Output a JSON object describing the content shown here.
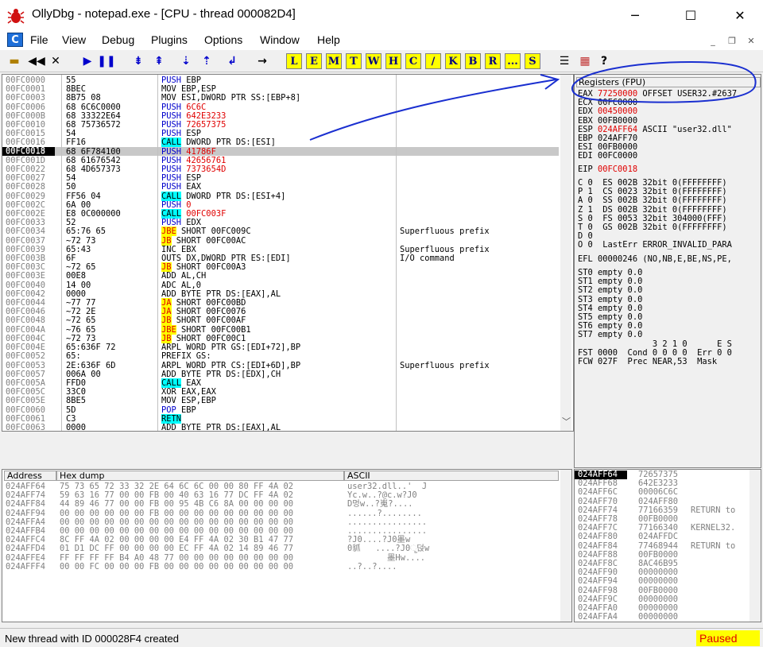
{
  "window": {
    "title": "OllyDbg - notepad.exe - [CPU - thread 000082D4]",
    "minimize": "─",
    "maximize": "☐",
    "close": "✕"
  },
  "menu": {
    "icon": "C",
    "items": [
      "File",
      "View",
      "Debug",
      "Plugins",
      "Options",
      "Window",
      "Help"
    ],
    "mdi_min": "_",
    "mdi_restore": "❐",
    "mdi_close": "✕"
  },
  "toolbar": {
    "letters": [
      "L",
      "E",
      "M",
      "T",
      "W",
      "H",
      "C",
      "/",
      "K",
      "B",
      "R",
      "...",
      "S"
    ]
  },
  "cpu": {
    "addresses": "00FC0000\n00FC0001\n00FC0003\n00FC0006\n00FC000B\n00FC0010\n00FC0015\n00FC0016\n00FC0018\n00FC001D\n00FC0022\n00FC0027\n00FC0028\n00FC0029\n00FC002C\n00FC002E\n00FC0033\n00FC0034\n00FC0037\n00FC0039\n00FC003B\n00FC003C\n00FC003E\n00FC0040\n00FC0042\n00FC0044\n00FC0046\n00FC0048\n00FC004A\n00FC004C\n00FC004E\n00FC0052\n00FC0053\n00FC0057\n00FC005A\n00FC005C\n00FC005E\n00FC0060\n00FC0061\n00FC0063",
    "hex": "55\n8BEC\n8B75 08\n68 6C6C0000\n68 33322E64\n68 75736572\n54\nFF16\n68 6F784100\n68 61676542\n68 4D657373\n54\n50\nFF56 04\n6A 00\nE8 0C000000\n52\n65:76 65\n~72 73\n65:43\n6F\n~72 65\n00E8\n14 00\n0000\n~77 77\n~72 2E\n~72 65\n~76 65\n~72 73\n65:636F 72\n65:\n2E:636F 6D\n006A 00\nFFD0\n33C0\n8BE5\n5D\nC3\n0000",
    "disasm": [
      "PUSH EBP",
      "MOV EBP,ESP",
      "MOV ESI,DWORD PTR SS:[EBP+8]",
      "PUSH 6C6C",
      "PUSH 642E3233",
      "PUSH 72657375",
      "PUSH ESP",
      "CALL DWORD PTR DS:[ESI]",
      "PUSH 41786F",
      "PUSH 42656761",
      "PUSH 7373654D",
      "PUSH ESP",
      "PUSH EAX",
      "CALL DWORD PTR DS:[ESI+4]",
      "PUSH 0",
      "CALL 00FC003F",
      "PUSH EDX",
      "JBE SHORT 00FC009C",
      "JB SHORT 00FC00AC",
      "INC EBX",
      "OUTS DX,DWORD PTR ES:[EDI]",
      "JB SHORT 00FC00A3",
      "ADD AL,CH",
      "ADC AL,0",
      "ADD BYTE PTR DS:[EAX],AL",
      "JA SHORT 00FC00BD",
      "JA SHORT 00FC0076",
      "JB SHORT 00FC00AF",
      "JBE SHORT 00FC00B1",
      "JB SHORT 00FC00C1",
      "ARPL WORD PTR GS:[EDI+72],BP",
      "PREFIX GS:",
      "ARPL WORD PTR CS:[EDI+6D],BP",
      "ADD BYTE PTR DS:[EDX],CH",
      "CALL EAX",
      "XOR EAX,EAX",
      "MOV ESP,EBP",
      "POP EBP",
      "RETN",
      "ADD BYTE PTR DS:[EAX],AL"
    ],
    "comments": "\n\n\n\n\n\n\n\n\n\n\n\n\n\n\n\n\nSuperfluous prefix\n\nSuperfluous prefix\nI/O command\n\n\n\n\n\n\n\n\n\n\n\nSuperfluous prefix\n\n\n\n\n\n\n"
  },
  "registers": {
    "title": "Registers (FPU)",
    "gp": [
      {
        "name": "EAX",
        "value": "77250000",
        "comment": "OFFSET USER32.#2637"
      },
      {
        "name": "ECX",
        "value": "00FC0000",
        "comment": ""
      },
      {
        "name": "EDX",
        "value": "00450000",
        "comment": ""
      },
      {
        "name": "EBX",
        "value": "00FB0000",
        "comment": ""
      },
      {
        "name": "ESP",
        "value": "024AFF64",
        "comment": "ASCII \"user32.dll\""
      },
      {
        "name": "EBP",
        "value": "024AFF70",
        "comment": ""
      },
      {
        "name": "ESI",
        "value": "00FB0000",
        "comment": ""
      },
      {
        "name": "EDI",
        "value": "00FC0000",
        "comment": ""
      }
    ],
    "eip": "EIP 00FC0018",
    "flags": "C 0  ES 002B 32bit 0(FFFFFFFF)\nP 1  CS 0023 32bit 0(FFFFFFFF)\nA 0  SS 002B 32bit 0(FFFFFFFF)\nZ 1  DS 002B 32bit 0(FFFFFFFF)\nS 0  FS 0053 32bit 304000(FFF)\nT 0  GS 002B 32bit 0(FFFFFFFF)\nD 0\nO 0  LastErr ERROR_INVALID_PARA",
    "efl": "EFL 00000246 (NO,NB,E,BE,NS,PE,",
    "fpu": "ST0 empty 0.0\nST1 empty 0.0\nST2 empty 0.0\nST3 empty 0.0\nST4 empty 0.0\nST5 empty 0.0\nST6 empty 0.0\nST7 empty 0.0\n               3 2 1 0      E S\nFST 0000  Cond 0 0 0 0  Err 0 0\nFCW 027F  Prec NEAR,53  Mask"
  },
  "dump": {
    "headers": [
      "Address",
      "Hex dump",
      "ASCII"
    ],
    "addresses": "024AFF64\n024AFF74\n024AFF84\n024AFF94\n024AFFA4\n024AFFB4\n024AFFC4\n024AFFD4\n024AFFE4\n024AFFF4",
    "hex": "75 73 65 72 33 32 2E 64 6C 6C 00 00 80 FF 4A 02\n59 63 16 77 00 00 FB 00 40 63 16 77 DC FF 4A 02\n44 89 46 77 00 00 FB 00 95 4B C6 8A 00 00 00 00\n00 00 00 00 00 00 FB 00 00 00 00 00 00 00 00 00\n00 00 00 00 00 00 00 00 00 00 00 00 00 00 00 00\n00 00 00 00 00 00 00 00 00 00 00 00 00 00 00 00\n8C FF 4A 02 00 00 00 00 E4 FF 4A 02 30 B1 47 77\n01 D1 DC FF 00 00 00 00 EC FF 4A 02 14 89 46 77\nFF FF FF FF B4 A0 48 77 00 00 00 00 00 00 00 00\n00 00 FC 00 00 00 FB 00 00 00 00 00 00 00 00 00",
    "ascii": "user32.dll..'  J\nYc.w..?@c.w?J0\nD멍w..?嵬?....\n......?........\n................\n................\n?J0....?J0墨w\n0䝖   ....?J0ୄ덙w\n        墨Hw....\n..?..?...."
  },
  "stack": {
    "addresses": "024AFF64\n024AFF68\n024AFF6C\n024AFF70\n024AFF74\n024AFF78\n024AFF7C\n024AFF80\n024AFF84\n024AFF88\n024AFF8C\n024AFF90\n024AFF94\n024AFF98\n024AFF9C\n024AFFA0\n024AFFA4",
    "values": "72657375\n642E3233\n00006C6C\n024AFF80\n77166359\n00FB0000\n77166340\n024AFFDC\n77468944\n00FB0000\n8AC46B95\n00000000\n00000000\n00FB0000\n00000000\n00000000\n00000000",
    "comments": "\n\n\n\nRETURN to\n\nKERNEL32.\n\nRETURN to\n\n\n\n\n\n\n\n"
  },
  "status": {
    "text": "New thread with ID 000028F4 created",
    "state": "Paused"
  }
}
